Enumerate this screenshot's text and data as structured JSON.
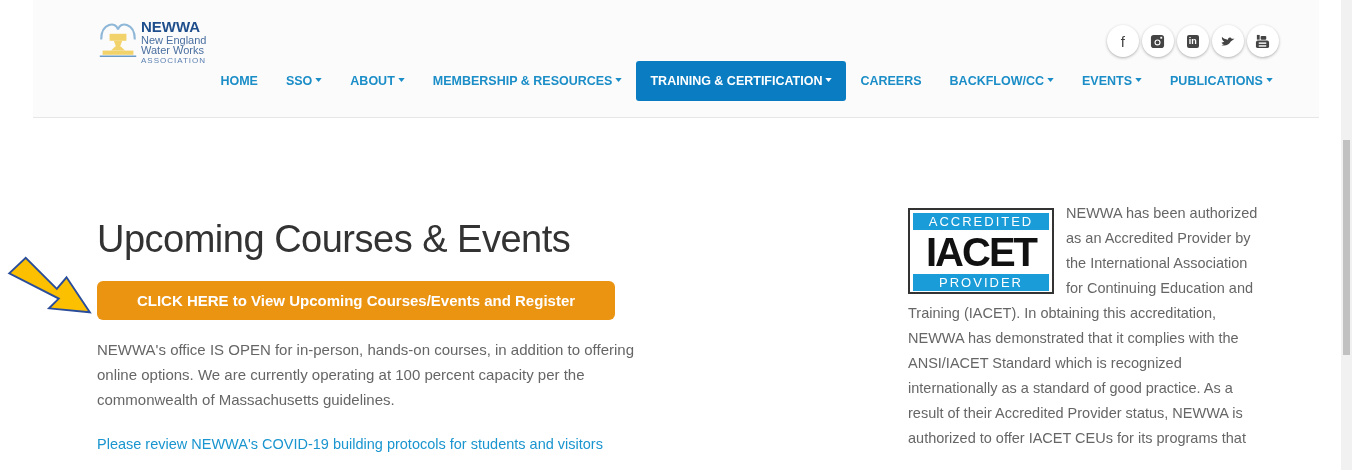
{
  "logo": {
    "name": "NEWWA",
    "line_1": "New England",
    "line_2": "Water Works",
    "line_3": "ASSOCIATION"
  },
  "social": [
    {
      "kind": "letter",
      "glyph": "f"
    },
    {
      "kind": "camera"
    },
    {
      "kind": "letter-box",
      "glyph": "in"
    },
    {
      "kind": "bird"
    },
    {
      "kind": "tube"
    }
  ],
  "nav": [
    {
      "label": "HOME",
      "dropdown": false,
      "selected": false
    },
    {
      "label": "SSO",
      "dropdown": true,
      "selected": false
    },
    {
      "label": "ABOUT",
      "dropdown": true,
      "selected": false
    },
    {
      "label": "MEMBERSHIP & RESOURCES",
      "dropdown": true,
      "selected": false
    },
    {
      "label": "TRAINING & CERTIFICATION",
      "dropdown": true,
      "selected": true
    },
    {
      "label": "CAREERS",
      "dropdown": false,
      "selected": false
    },
    {
      "label": "BACKFLOW/CC",
      "dropdown": true,
      "selected": false
    },
    {
      "label": "EVENTS",
      "dropdown": true,
      "selected": false
    },
    {
      "label": "PUBLICATIONS",
      "dropdown": true,
      "selected": false
    }
  ],
  "main": {
    "heading": "Upcoming Courses & Events",
    "register_button": "CLICK HERE to View Upcoming Courses/Events and Register",
    "paragraph": "NEWWA's office IS OPEN for in-person, hands-on courses, in addition to offering online options. We are currently operating at 100 percent capacity per the commonwealth of Massachusetts guidelines.",
    "link": "Please review NEWWA's COVID-19 building protocols for students and visitors"
  },
  "badge": {
    "top": "ACCREDITED",
    "middle": "IACET",
    "bottom": "PROVIDER"
  },
  "accreditation_text": [
    "NEWWA has been authorized as an Accredited Provider by the International Association for Continuing Education and",
    "Training (IACET). In obtaining this accreditation, NEWWA has demonstrated that it complies with the ANSI/IACET Standard which is recognized internationally as a standard of good practice. As a result of their Accredited Provider status, NEWWA is authorized to offer IACET CEUs for its programs that"
  ]
}
